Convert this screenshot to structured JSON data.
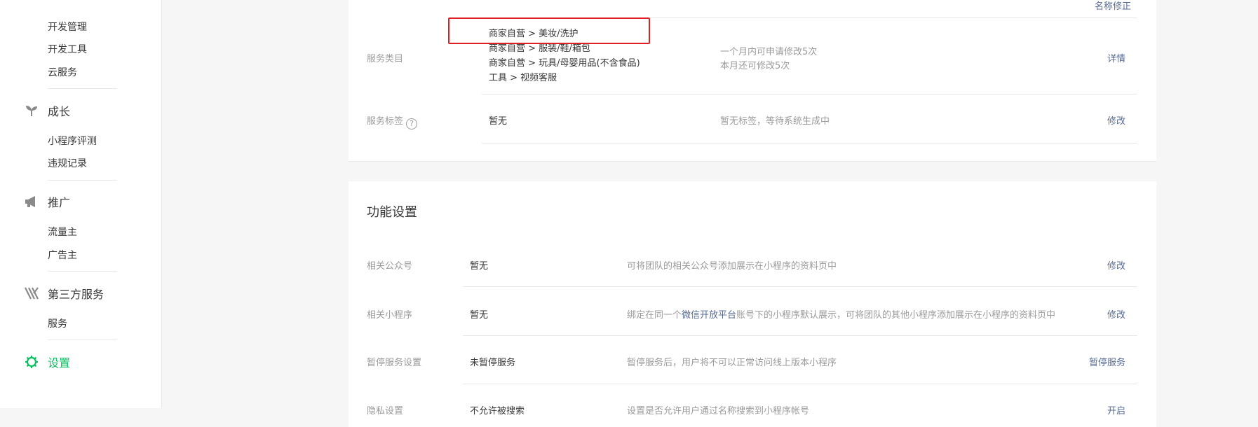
{
  "sidebar": {
    "dev_items": [
      "开发管理",
      "开发工具",
      "云服务"
    ],
    "growth": {
      "title": "成长",
      "items": [
        "小程序评测",
        "违规记录"
      ]
    },
    "promote": {
      "title": "推广",
      "items": [
        "流量主",
        "广告主"
      ]
    },
    "third_party": {
      "title": "第三方服务",
      "items": [
        "服务"
      ]
    },
    "settings": {
      "title": "设置"
    },
    "accent_color": "#07c160"
  },
  "service_info": {
    "top_link": "名称修正",
    "category": {
      "label": "服务类目",
      "lines": [
        "商家自营 > 美妆/洗护",
        "商家自营 > 服装/鞋/箱包",
        "商家自营 > 玩具/母婴用品(不含食品)",
        "工具 > 视频客服"
      ],
      "desc_1": "一个月内可申请修改5次",
      "desc_2": "本月还可修改5次",
      "action": "详情"
    },
    "tags": {
      "label": "服务标签",
      "help": "?",
      "value": "暂无",
      "desc": "暂无标签，等待系统生成中",
      "action": "修改"
    }
  },
  "features": {
    "title": "功能设置",
    "rows": [
      {
        "label": "相关公众号",
        "value": "暂无",
        "desc": "可将团队的相关公众号添加展示在小程序的资料页中",
        "action": "修改"
      },
      {
        "label": "相关小程序",
        "value": "暂无",
        "desc_pre": "绑定在同一个",
        "desc_link": "微信开放平台",
        "desc_post": "账号下的小程序默认展示，可将团队的其他小程序添加展示在小程序的资料页中",
        "action": "修改"
      },
      {
        "label": "暂停服务设置",
        "value": "未暂停服务",
        "desc": "暂停服务后，用户将不可以正常访问线上版本小程序",
        "action": "暂停服务"
      },
      {
        "label": "隐私设置",
        "value": "不允许被搜索",
        "desc": "设置是否允许用户通过名称搜索到小程序帐号",
        "action": "开启"
      }
    ]
  },
  "link_color": "#576b95",
  "highlight_color": "#e02020"
}
